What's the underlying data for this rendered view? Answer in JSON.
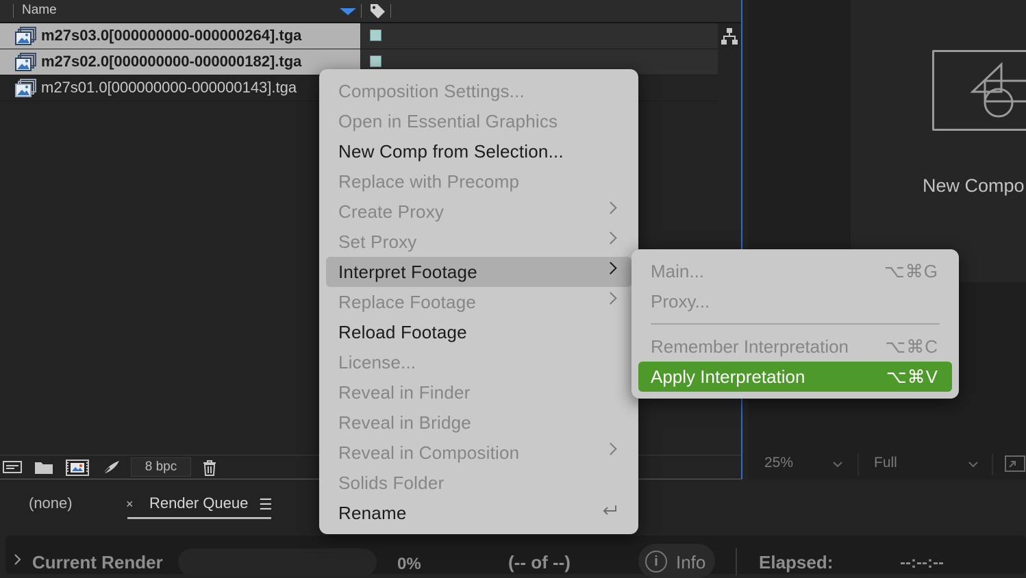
{
  "project_panel": {
    "column_name": "Name",
    "files": [
      {
        "name": "m27s03.0[000000000-000000264].tga",
        "selected": true
      },
      {
        "name": "m27s02.0[000000000-000000182].tga",
        "selected": true
      },
      {
        "name": "m27s01.0[000000000-000000143].tga",
        "selected": false
      }
    ],
    "label_color": "#a9d0cc",
    "bpc": "8 bpc"
  },
  "context_menu": {
    "items": [
      {
        "label": "Composition Settings...",
        "enabled": false
      },
      {
        "label": "Open in Essential Graphics",
        "enabled": false
      },
      {
        "label": "New Comp from Selection...",
        "enabled": true
      },
      {
        "label": "Replace with Precomp",
        "enabled": false
      },
      {
        "label": "Create Proxy",
        "enabled": false,
        "submenu": true
      },
      {
        "label": "Set Proxy",
        "enabled": false,
        "submenu": true
      },
      {
        "label": "Interpret Footage",
        "enabled": true,
        "submenu": true,
        "highlighted": true
      },
      {
        "label": "Replace Footage",
        "enabled": false,
        "submenu": true
      },
      {
        "label": "Reload Footage",
        "enabled": true
      },
      {
        "label": "License...",
        "enabled": false
      },
      {
        "label": "Reveal in Finder",
        "enabled": false
      },
      {
        "label": "Reveal in Bridge",
        "enabled": false
      },
      {
        "label": "Reveal in Composition",
        "enabled": false,
        "submenu": true
      },
      {
        "label": "Solids Folder",
        "enabled": false
      },
      {
        "label": "Rename",
        "enabled": true
      }
    ]
  },
  "submenu": {
    "items": [
      {
        "label": "Main...",
        "shortcut": "⌥⌘G",
        "enabled": false
      },
      {
        "label": "Proxy...",
        "shortcut": "",
        "enabled": false
      },
      {
        "label": "Remember Interpretation",
        "shortcut": "⌥⌘C",
        "enabled": false
      },
      {
        "label": "Apply Interpretation",
        "shortcut": "⌥⌘V",
        "enabled": true,
        "active": true
      }
    ],
    "active_color": "#4d9a2b"
  },
  "viewer": {
    "new_comp_label": "New Compo",
    "zoom": "25%",
    "resolution": "Full"
  },
  "bottom_panel": {
    "tab_none": "(none)",
    "tab_close": "×",
    "tab_render_queue": "Render Queue",
    "tab_menu": "☰",
    "current_render": "Current Render",
    "percent": "0%",
    "of_count": "(-- of --)",
    "info": "Info",
    "elapsed_label": "Elapsed:",
    "elapsed_value": "--:--:--"
  }
}
